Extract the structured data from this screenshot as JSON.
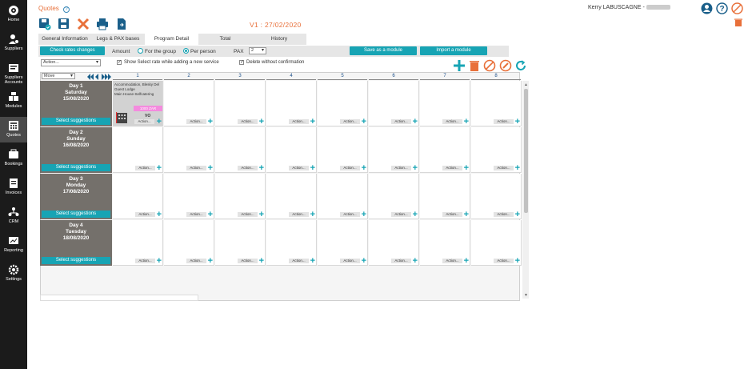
{
  "nav": [
    {
      "label": "Home",
      "icon": "home-icon"
    },
    {
      "label": "Suppliers",
      "icon": "suppliers-icon"
    },
    {
      "label": "Suppliers Accounts",
      "icon": "suppliers-accounts-icon"
    },
    {
      "label": "Modules",
      "icon": "modules-icon"
    },
    {
      "label": "Quotes",
      "icon": "quotes-icon",
      "active": true
    },
    {
      "label": "Bookings",
      "icon": "bookings-icon"
    },
    {
      "label": "Invoices",
      "icon": "invoices-icon"
    },
    {
      "label": "CRM",
      "icon": "crm-icon"
    },
    {
      "label": "Reporting",
      "icon": "reporting-icon"
    },
    {
      "label": "Settings",
      "icon": "settings-icon"
    }
  ],
  "header": {
    "title": "Quotes",
    "user": "Kerry LABUSCAGNE -",
    "version": "V1 : 27/02/2020"
  },
  "tabs": [
    "General Information",
    "Legs & PAX bases",
    "Program Detail",
    "Total",
    "History"
  ],
  "active_tab": "Program Detail",
  "options": {
    "check_rates": "Check rates changes",
    "amount_label": "Amount",
    "for_group": "For the group",
    "per_person": "Per person",
    "pax_label": "PAX",
    "pax_value": "2",
    "save_module": "Save as a module",
    "import_module": "Import a module",
    "action_select": "Action...",
    "show_select_rate": "Show Select rate while adding a new service",
    "delete_without_confirm": "Delete without confirmation",
    "move_select": "Move"
  },
  "columns": [
    "1",
    "2",
    "3",
    "4",
    "5",
    "6",
    "7",
    "8"
  ],
  "days": [
    {
      "day": "Day 1",
      "weekday": "Saturday",
      "date": "15/08/2020"
    },
    {
      "day": "Day 2",
      "weekday": "Sunday",
      "date": "16/08/2020"
    },
    {
      "day": "Day 3",
      "weekday": "Monday",
      "date": "17/08/2020"
    },
    {
      "day": "Day 4",
      "weekday": "Tuesday",
      "date": "18/08/2020"
    }
  ],
  "select_suggestions": "Select suggestions",
  "cell_action": "Action...",
  "service": {
    "line1": "Accommodation, Blesky Del",
    "line2": "Guest Lodge",
    "line3": "Main House-Selfcatering",
    "price": "1000 ZAR",
    "code": "VO"
  },
  "colors": {
    "accent": "#17a4b4",
    "brand": "#e8703a",
    "sidebar": "#1b1b1b",
    "day_header": "#74706b"
  }
}
